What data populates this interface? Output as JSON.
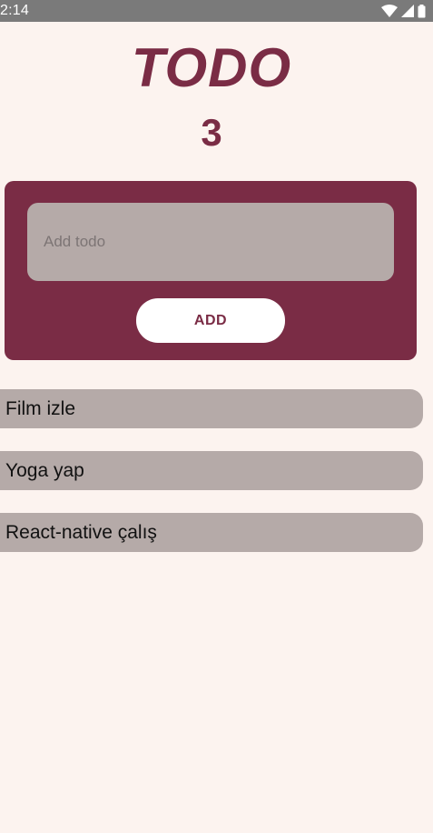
{
  "status_bar": {
    "time": "2:14",
    "icons": [
      "wifi-icon",
      "signal-icon",
      "battery-icon"
    ]
  },
  "header": {
    "title": "TODO",
    "count": "3"
  },
  "form": {
    "input_placeholder": "Add todo",
    "input_value": "",
    "add_label": "ADD"
  },
  "todos": [
    {
      "text": "Film izle"
    },
    {
      "text": "Yoga yap"
    },
    {
      "text": "React-native çalış"
    }
  ],
  "colors": {
    "accent": "#7a2c45",
    "background": "#fcf3ef",
    "item_background": "#b5aaa8",
    "status_bar": "#7a7a7a"
  }
}
